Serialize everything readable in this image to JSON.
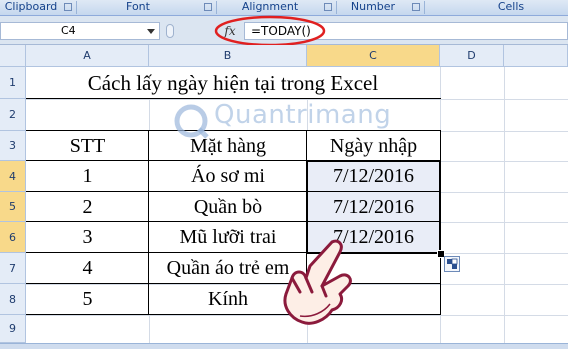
{
  "ribbon": {
    "groups": [
      "Clipboard",
      "Font",
      "Alignment",
      "Number",
      "Cells"
    ]
  },
  "formula_bar": {
    "name_box": "C4",
    "fx_label": "fx",
    "formula": "=TODAY()"
  },
  "sheet": {
    "columns": [
      "A",
      "B",
      "C",
      "D"
    ],
    "rows": [
      "1",
      "2",
      "3",
      "4",
      "5",
      "6",
      "7",
      "8",
      "9"
    ],
    "title": "Cách lấy ngày hiện tại trong Excel",
    "headers": {
      "stt": "STT",
      "item": "Mặt hàng",
      "date": "Ngày nhập"
    },
    "data": [
      {
        "stt": "1",
        "item": "Áo sơ mi",
        "date": "7/12/2016"
      },
      {
        "stt": "2",
        "item": "Quần bò",
        "date": "7/12/2016"
      },
      {
        "stt": "3",
        "item": "Mũ lưỡi trai",
        "date": "7/12/2016"
      },
      {
        "stt": "4",
        "item": "Quần áo trẻ em",
        "date": ""
      },
      {
        "stt": "5",
        "item": "Kính",
        "date": ""
      }
    ]
  },
  "watermark": "Quantrimang",
  "colors": {
    "selection": "#e9edf7",
    "highlight_circle": "#e02020",
    "accent": "#15428b"
  }
}
